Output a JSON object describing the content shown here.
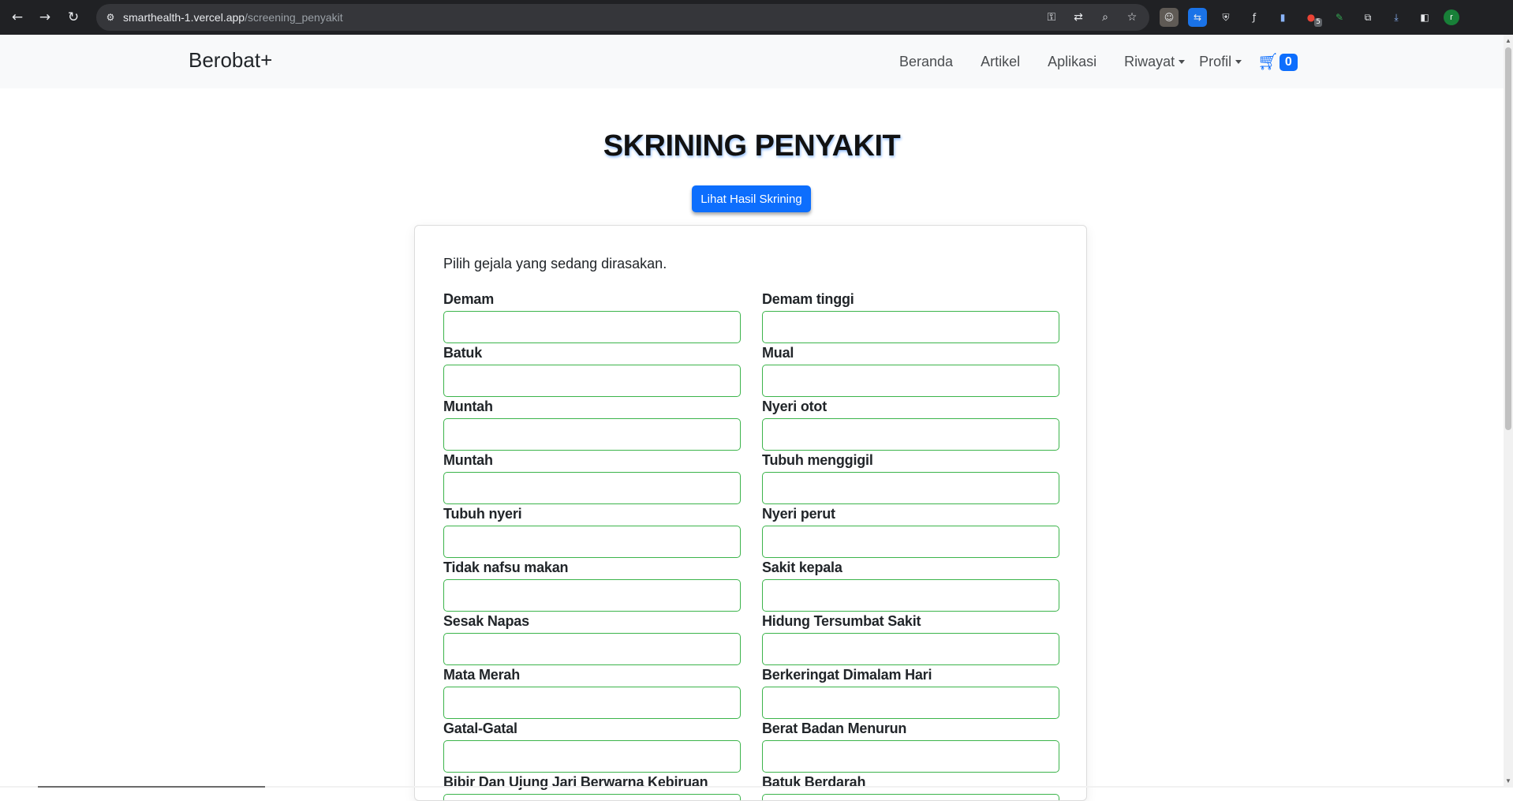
{
  "browser": {
    "url_domain": "smarthealth-1.vercel.app",
    "url_path": "/screening_penyakit",
    "back_icon": "arrow-left-icon",
    "forward_icon": "arrow-right-icon",
    "reload_icon": "reload-icon",
    "extension_badge": "5",
    "profile_initial": "r"
  },
  "navbar": {
    "brand": "Berobat+",
    "links": [
      "Beranda",
      "Artikel",
      "Aplikasi"
    ],
    "dropdowns": [
      "Riwayat",
      "Profil"
    ],
    "cart_count": "0"
  },
  "page": {
    "title": "SKRINING PENYAKIT",
    "result_button": "Lihat Hasil Skrining",
    "intro": "Pilih gejala yang sedang dirasakan.",
    "symptoms": [
      "Demam",
      "Demam tinggi",
      "Batuk",
      "Mual",
      "Muntah",
      "Nyeri otot",
      "Muntah",
      "Tubuh menggigil",
      "Tubuh nyeri",
      "Nyeri perut",
      "Tidak nafsu makan",
      "Sakit kepala",
      "Sesak Napas",
      "Hidung Tersumbat Sakit",
      "Mata Merah",
      "Berkeringat Dimalam Hari",
      "Gatal-Gatal",
      "Berat Badan Menurun",
      "Bibir Dan Ujung Jari Berwarna Kebiruan",
      "Batuk Berdarah"
    ]
  },
  "colors": {
    "primary": "#0d6efd",
    "input_border": "#3cb44b",
    "navbar_bg": "#f8f9fa"
  }
}
